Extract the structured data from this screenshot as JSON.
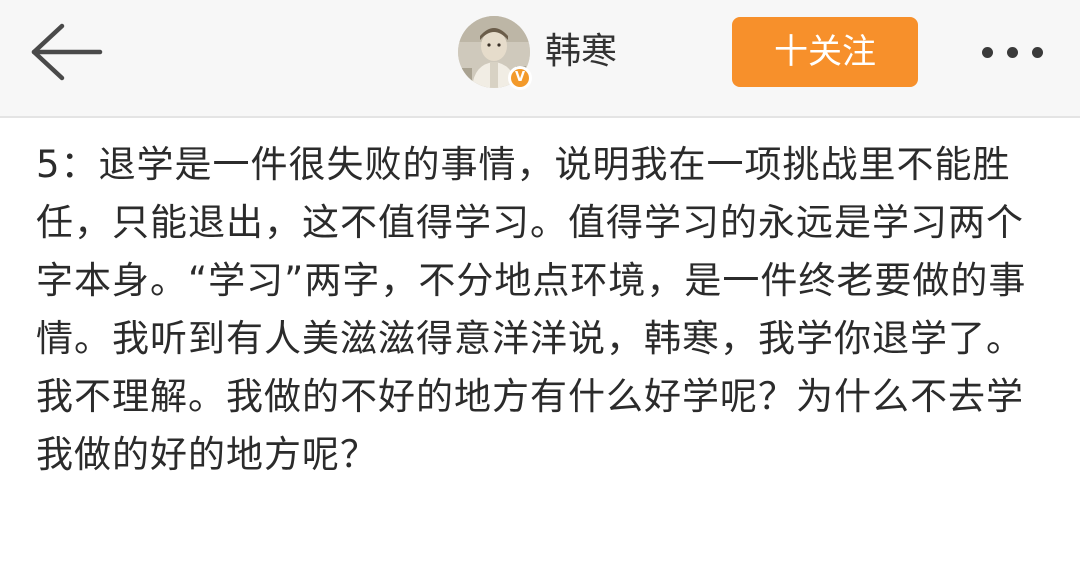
{
  "header": {
    "back_icon": "arrow-left-icon",
    "username": "韩寒",
    "verified_icon": "verified-v-icon",
    "follow_label": "十关注",
    "more_icon": "more-dots-icon",
    "colors": {
      "follow_bg": "#f7902b",
      "verified_badge": "#f39a2b",
      "header_bg": "#f7f7f7"
    }
  },
  "post": {
    "text": "5：退学是一件很失败的事情，说明我在一项挑战里不能胜任，只能退出，这不值得学习。值得学习的永远是学习两个字本身。“学习”两字，不分地点环境，是一件终老要做的事情。我听到有人美滋滋得意洋洋说，韩寒，我学你退学了。我不理解。我做的不好的地方有什么好学呢？为什么不去学我做的好的地方呢？"
  }
}
